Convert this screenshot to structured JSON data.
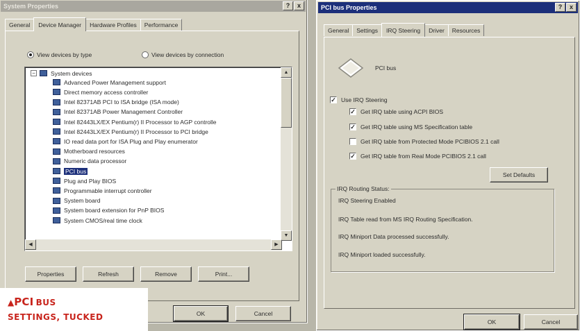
{
  "left_window": {
    "title": "System Properties",
    "tabs": [
      "General",
      "Device Manager",
      "Hardware Profiles",
      "Performance"
    ],
    "view_by_type_label": "View devices by type",
    "view_by_connection_label": "View devices by connection",
    "tree_root": "System devices",
    "devices": [
      "Advanced Power Management support",
      "Direct memory access controller",
      "Intel 82371AB PCI to ISA bridge (ISA mode)",
      "Intel 82371AB Power Management Controller",
      "Intel 82443LX/EX Pentium(r) II Processor to AGP controlle",
      "Intel 82443LX/EX Pentium(r) II Processor to PCI bridge",
      "IO read data port for ISA Plug and Play enumerator",
      "Motherboard resources",
      "Numeric data processor",
      "PCI bus",
      "Plug and Play BIOS",
      "Programmable interrupt controller",
      "System board",
      "System board extension for PnP BIOS",
      "System CMOS/real time clock"
    ],
    "selected_device": "PCI bus",
    "buttons": [
      "Properties",
      "Refresh",
      "Remove",
      "Print..."
    ],
    "ok_label": "OK",
    "cancel_label": "Cancel"
  },
  "right_window": {
    "title": "PCI bus Properties",
    "tabs": [
      "General",
      "Settings",
      "IRQ Steering",
      "Driver",
      "Resources"
    ],
    "device_name": "PCI bus",
    "use_irq_label": "Use IRQ Steering",
    "options": [
      {
        "label": "Get IRQ table using ACPI BIOS",
        "checked": true
      },
      {
        "label": "Get IRQ table using MS Specification table",
        "checked": true
      },
      {
        "label": "Get IRQ table from Protected Mode PCIBIOS 2.1 call",
        "checked": false
      },
      {
        "label": "Get IRQ table from Real Mode PCIBIOS 2.1 call",
        "checked": true
      }
    ],
    "set_defaults_label": "Set Defaults",
    "routing_status_label": "IRQ Routing Status:",
    "status_lines": [
      "IRQ Steering Enabled",
      "IRQ Table read from MS IRQ Routing Specification.",
      "IRQ Miniport Data processed successfully.",
      "IRQ Miniport loaded successfully."
    ],
    "ok_label": "OK",
    "cancel_label": "Cancel",
    "help_glyph": "?",
    "close_glyph": "x"
  },
  "caption": {
    "marker": "▲",
    "line1": "PCI",
    "line1_small": "BUS",
    "line2": "SETTINGS, TUCKED"
  },
  "colors": {
    "selection": "#1c2f7a",
    "caption_red": "#c8241c"
  }
}
